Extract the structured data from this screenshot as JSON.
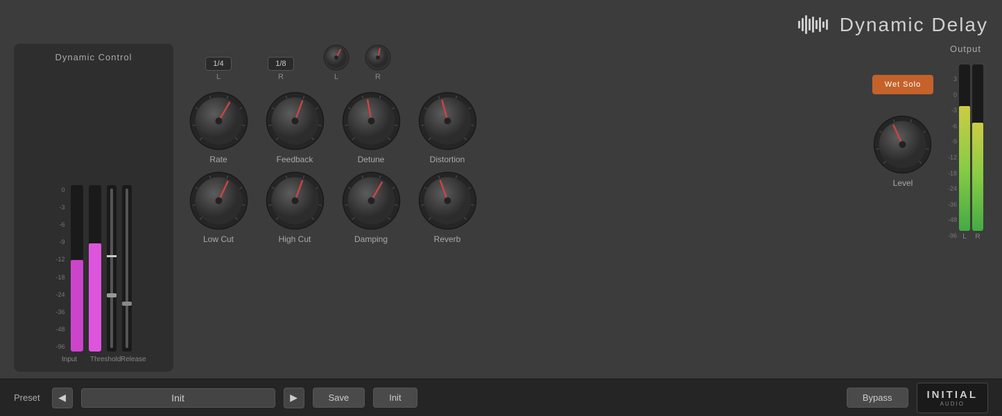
{
  "header": {
    "title": "Dynamic Delay",
    "icon": "waveform"
  },
  "dynamicControl": {
    "title": "Dynamic Control",
    "scale": [
      "0",
      "-3",
      "-6",
      "-9",
      "-12",
      "-18",
      "-24",
      "-36",
      "-48",
      "-96"
    ],
    "inputLabel": "Input",
    "thresholdLabel": "Threshold",
    "releaseLabel": "Release",
    "inputLevel": 55,
    "inputLevel2": 65
  },
  "timingControls": {
    "leftButton": "1/4",
    "leftLabel": "L",
    "rightButton": "1/8",
    "rightLabel": "R"
  },
  "knobs": {
    "row1": [
      {
        "id": "rate",
        "label": "Rate",
        "angle": 30
      },
      {
        "id": "feedback",
        "label": "Feedback",
        "angle": 20
      },
      {
        "id": "detune",
        "label": "Detune",
        "angle": -10
      },
      {
        "id": "distortion",
        "label": "Distortion",
        "angle": -15
      }
    ],
    "row2": [
      {
        "id": "lowcut",
        "label": "Low Cut",
        "angle": 25
      },
      {
        "id": "highcut",
        "label": "High Cut",
        "angle": 20
      },
      {
        "id": "damping",
        "label": "Damping",
        "angle": 30
      },
      {
        "id": "reverb",
        "label": "Reverb",
        "angle": -20
      },
      {
        "id": "level",
        "label": "Level",
        "angle": -25
      }
    ]
  },
  "miniKnobs": {
    "left": {
      "label": "L",
      "angle": 5
    },
    "right": {
      "label": "R",
      "angle": -10
    }
  },
  "output": {
    "title": "Output",
    "wetSoloLabel": "Wet Solo",
    "scale": [
      "3",
      "0",
      "-3",
      "-6",
      "-9",
      "-12",
      "-18",
      "-24",
      "-36",
      "-48",
      "-96"
    ],
    "leftLevel": 75,
    "rightLevel": 65,
    "leftLabel": "L",
    "rightLabel": "R"
  },
  "bottomBar": {
    "presetLabel": "Preset",
    "prevButton": "◀",
    "nextButton": "▶",
    "presetName": "Init",
    "saveButton": "Save",
    "initButton": "Init",
    "bypassButton": "Bypass",
    "brandName": "INITIAL",
    "brandSub": "AUDIO"
  }
}
